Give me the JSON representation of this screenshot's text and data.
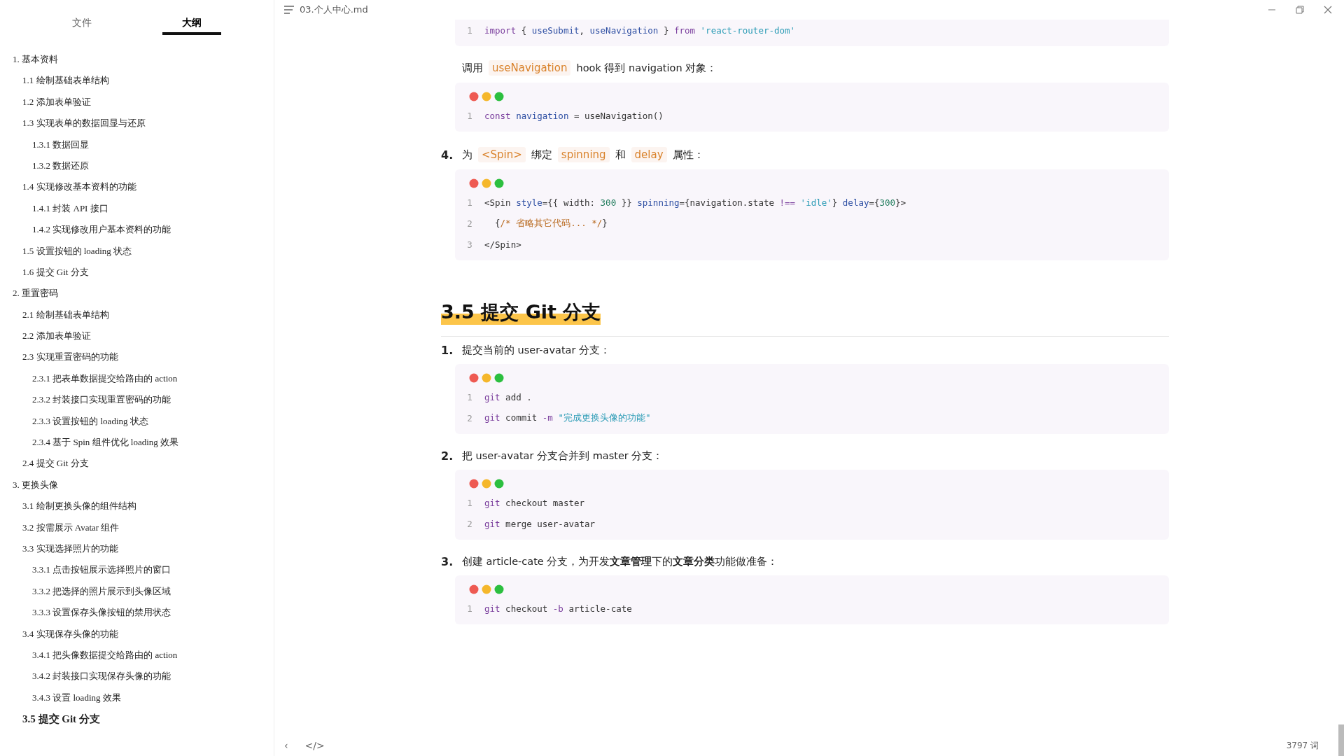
{
  "sidebar": {
    "tabs": [
      {
        "label": "文件",
        "selected": false
      },
      {
        "label": "大纲",
        "selected": true
      }
    ],
    "outline": [
      {
        "label": "1. 基本资料",
        "selected": false,
        "children": [
          {
            "label": "1.1 绘制基础表单结构",
            "selected": false
          },
          {
            "label": "1.2 添加表单验证",
            "selected": false
          },
          {
            "label": "1.3 实现表单的数据回显与还原",
            "selected": false,
            "children": [
              {
                "label": "1.3.1 数据回显",
                "selected": false
              },
              {
                "label": "1.3.2 数据还原",
                "selected": false
              }
            ]
          },
          {
            "label": "1.4 实现修改基本资料的功能",
            "selected": false,
            "children": [
              {
                "label": "1.4.1 封装 API 接口",
                "selected": false
              },
              {
                "label": "1.4.2 实现修改用户基本资料的功能",
                "selected": false
              }
            ]
          },
          {
            "label": "1.5 设置按钮的 loading 状态",
            "selected": false
          },
          {
            "label": "1.6 提交 Git 分支",
            "selected": false
          }
        ]
      },
      {
        "label": "2. 重置密码",
        "selected": false,
        "children": [
          {
            "label": "2.1 绘制基础表单结构",
            "selected": false
          },
          {
            "label": "2.2 添加表单验证",
            "selected": false
          },
          {
            "label": "2.3 实现重置密码的功能",
            "selected": false,
            "children": [
              {
                "label": "2.3.1 把表单数据提交给路由的 action",
                "selected": false
              },
              {
                "label": "2.3.2 封装接口实现重置密码的功能",
                "selected": false
              },
              {
                "label": "2.3.3 设置按钮的 loading 状态",
                "selected": false
              },
              {
                "label": "2.3.4 基于 Spin 组件优化 loading 效果",
                "selected": false
              }
            ]
          },
          {
            "label": "2.4 提交 Git 分支",
            "selected": false
          }
        ]
      },
      {
        "label": "3. 更换头像",
        "selected": false,
        "children": [
          {
            "label": "3.1 绘制更换头像的组件结构",
            "selected": false
          },
          {
            "label": "3.2 按需展示 Avatar 组件",
            "selected": false
          },
          {
            "label": "3.3 实现选择照片的功能",
            "selected": false,
            "children": [
              {
                "label": "3.3.1 点击按钮展示选择照片的窗口",
                "selected": false
              },
              {
                "label": "3.3.2 把选择的照片展示到头像区域",
                "selected": false
              },
              {
                "label": "3.3.3 设置保存头像按钮的禁用状态",
                "selected": false
              }
            ]
          },
          {
            "label": "3.4 实现保存头像的功能",
            "selected": false,
            "children": [
              {
                "label": "3.4.1 把头像数据提交给路由的 action",
                "selected": false
              },
              {
                "label": "3.4.2 封装接口实现保存头像的功能",
                "selected": false
              },
              {
                "label": "3.4.3 设置 loading 效果",
                "selected": false
              }
            ]
          },
          {
            "label": "3.5 提交 Git 分支",
            "selected": true
          }
        ]
      }
    ]
  },
  "title_bar": {
    "filename": "03.个人中心.md"
  },
  "blocks": [
    {
      "kind": "code",
      "cut_top": true,
      "lines": [
        {
          "number": "1",
          "tokens": [
            {
              "kind": "keyword",
              "text": "import"
            },
            {
              "kind": "plain",
              "text": " { "
            },
            {
              "kind": "name",
              "text": "useSubmit"
            },
            {
              "kind": "plain",
              "text": ", "
            },
            {
              "kind": "name",
              "text": "useNavigation"
            },
            {
              "kind": "plain",
              "text": " } "
            },
            {
              "kind": "keyword",
              "text": "from "
            },
            {
              "kind": "string",
              "text": "'react-router-dom'"
            }
          ]
        }
      ]
    },
    {
      "kind": "paragraph",
      "segments": [
        {
          "kind": "text",
          "text": "调用"
        },
        {
          "kind": "code",
          "text": "useNavigation"
        },
        {
          "kind": "text",
          "text": "hook 得到 navigation 对象："
        }
      ]
    },
    {
      "kind": "code",
      "cut_top": false,
      "lines": [
        {
          "number": "1",
          "tokens": [
            {
              "kind": "keyword",
              "text": "const "
            },
            {
              "kind": "name",
              "text": "navigation"
            },
            {
              "kind": "plain",
              "text": " = useNavigation()"
            }
          ]
        }
      ]
    },
    {
      "kind": "item",
      "number": "4.",
      "segments": [
        {
          "kind": "text",
          "text": "为"
        },
        {
          "kind": "code",
          "text": "<Spin>"
        },
        {
          "kind": "text",
          "text": "绑定"
        },
        {
          "kind": "code",
          "text": "spinning"
        },
        {
          "kind": "text",
          "text": "和"
        },
        {
          "kind": "code",
          "text": "delay"
        },
        {
          "kind": "text",
          "text": "属性："
        }
      ]
    },
    {
      "kind": "code",
      "cut_top": false,
      "lines": [
        {
          "number": "1",
          "tokens": [
            {
              "kind": "plain",
              "text": "<Spin "
            },
            {
              "kind": "name",
              "text": "style"
            },
            {
              "kind": "plain",
              "text": "={{ width: "
            },
            {
              "kind": "number",
              "text": "300"
            },
            {
              "kind": "plain",
              "text": " }} "
            },
            {
              "kind": "name",
              "text": "spinning"
            },
            {
              "kind": "plain",
              "text": "={navigation.state "
            },
            {
              "kind": "keyword",
              "text": "!== "
            },
            {
              "kind": "string",
              "text": "'idle'"
            },
            {
              "kind": "plain",
              "text": "} "
            },
            {
              "kind": "name",
              "text": "delay"
            },
            {
              "kind": "plain",
              "text": "={"
            },
            {
              "kind": "number",
              "text": "300"
            },
            {
              "kind": "plain",
              "text": "}>"
            }
          ]
        },
        {
          "number": "2",
          "tokens": [
            {
              "kind": "plain",
              "text": "  {"
            },
            {
              "kind": "comment",
              "text": "/* 省略其它代码... */"
            },
            {
              "kind": "plain",
              "text": "}"
            }
          ]
        },
        {
          "number": "3",
          "tokens": [
            {
              "kind": "plain",
              "text": "</Spin>"
            }
          ]
        }
      ]
    },
    {
      "kind": "heading",
      "text": "3.5 提交 Git 分支"
    },
    {
      "kind": "item",
      "number": "1.",
      "segments": [
        {
          "kind": "text",
          "text": "提交当前的 user-avatar 分支："
        }
      ]
    },
    {
      "kind": "code",
      "cut_top": false,
      "lines": [
        {
          "number": "1",
          "tokens": [
            {
              "kind": "keyword",
              "text": "git"
            },
            {
              "kind": "plain",
              "text": " add ."
            }
          ]
        },
        {
          "number": "2",
          "tokens": [
            {
              "kind": "keyword",
              "text": "git"
            },
            {
              "kind": "plain",
              "text": " commit "
            },
            {
              "kind": "keyword",
              "text": "-m "
            },
            {
              "kind": "string",
              "text": "\"完成更换头像的功能\""
            }
          ]
        }
      ]
    },
    {
      "kind": "item",
      "number": "2.",
      "segments": [
        {
          "kind": "text",
          "text": "把 user-avatar 分支合并到 master 分支："
        }
      ]
    },
    {
      "kind": "code",
      "cut_top": false,
      "lines": [
        {
          "number": "1",
          "tokens": [
            {
              "kind": "keyword",
              "text": "git"
            },
            {
              "kind": "plain",
              "text": " checkout master"
            }
          ]
        },
        {
          "number": "2",
          "tokens": [
            {
              "kind": "keyword",
              "text": "git"
            },
            {
              "kind": "plain",
              "text": " merge user-avatar"
            }
          ]
        }
      ]
    },
    {
      "kind": "item",
      "number": "3.",
      "segments": [
        {
          "kind": "text",
          "text": "创建 article-cate 分支，为开发**文章管理**下的**文章分类**功能做准备："
        }
      ]
    },
    {
      "kind": "code",
      "cut_top": false,
      "lines": [
        {
          "number": "1",
          "tokens": [
            {
              "kind": "keyword",
              "text": "git"
            },
            {
              "kind": "plain",
              "text": " checkout "
            },
            {
              "kind": "keyword",
              "text": "-b"
            },
            {
              "kind": "plain",
              "text": " article-cate"
            }
          ]
        }
      ]
    }
  ],
  "footer": {
    "prev_symbol": "‹",
    "source_symbol": "</>",
    "word_count": "3797 词"
  }
}
